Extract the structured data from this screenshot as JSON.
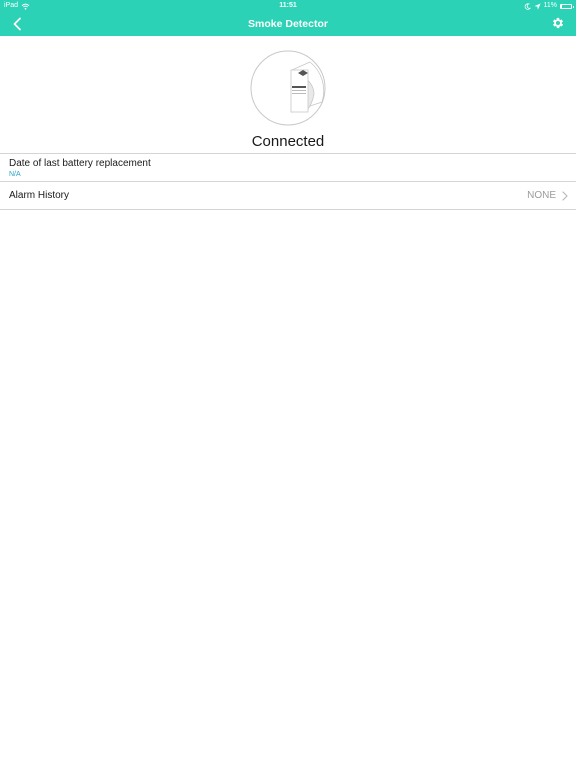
{
  "status_bar": {
    "device": "iPad",
    "time": "11:51",
    "battery": "11%",
    "battery_level": 0.11
  },
  "nav": {
    "title": "Smoke Detector",
    "back_icon": "chevron-left-icon",
    "settings_icon": "gear-icon"
  },
  "device": {
    "status": "Connected",
    "illustration_icon": "smoke-detector-icon"
  },
  "rows": {
    "battery": {
      "label": "Date of last battery replacement",
      "value": "N/A"
    },
    "alarm": {
      "label": "Alarm History",
      "value": "NONE"
    }
  },
  "colors": {
    "accent": "#2bd2b6",
    "link": "#2aa3c2",
    "divider": "#d5d5d5",
    "muted": "#9b9b9b"
  }
}
